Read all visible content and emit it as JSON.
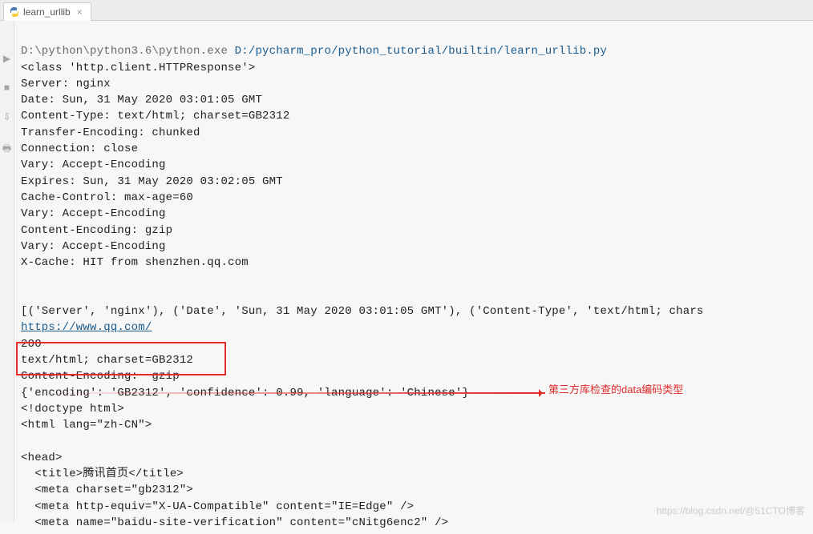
{
  "tab": {
    "label": "learn_urllib",
    "close": "×"
  },
  "cmd": {
    "exe_path": "D:\\python\\python3.6\\python.exe",
    "script_path": "D:/pycharm_pro/python_tutorial/builtin/learn_urllib.py"
  },
  "console": {
    "lines": [
      "<class 'http.client.HTTPResponse'>",
      "Server: nginx",
      "Date: Sun, 31 May 2020 03:01:05 GMT",
      "Content-Type: text/html; charset=GB2312",
      "Transfer-Encoding: chunked",
      "Connection: close",
      "Vary: Accept-Encoding",
      "Expires: Sun, 31 May 2020 03:02:05 GMT",
      "Cache-Control: max-age=60",
      "Vary: Accept-Encoding",
      "Content-Encoding: gzip",
      "Vary: Accept-Encoding",
      "X-Cache: HIT from shenzhen.qq.com",
      "",
      "",
      "[('Server', 'nginx'), ('Date', 'Sun, 31 May 2020 03:01:05 GMT'), ('Content-Type', 'text/html; chars"
    ],
    "url": "https://www.qq.com/",
    "status": "200",
    "boxed": [
      "text/html; charset=GB2312",
      "Content-Encoding:  gzip"
    ],
    "chardet": "{'encoding': 'GB2312', 'confidence': 0.99, 'language': 'Chinese'}",
    "html": [
      "<!doctype html>",
      "<html lang=\"zh-CN\">",
      "",
      "<head>",
      "  <title>腾讯首页</title>",
      "  <meta charset=\"gb2312\">",
      "  <meta http-equiv=\"X-UA-Compatible\" content=\"IE=Edge\" />",
      "  <meta name=\"baidu-site-verification\" content=\"cNitg6enc2\" />"
    ]
  },
  "annotation": "第三方库检查的data编码类型",
  "watermark": "https://blog.csdn.net/@51CTO博客"
}
